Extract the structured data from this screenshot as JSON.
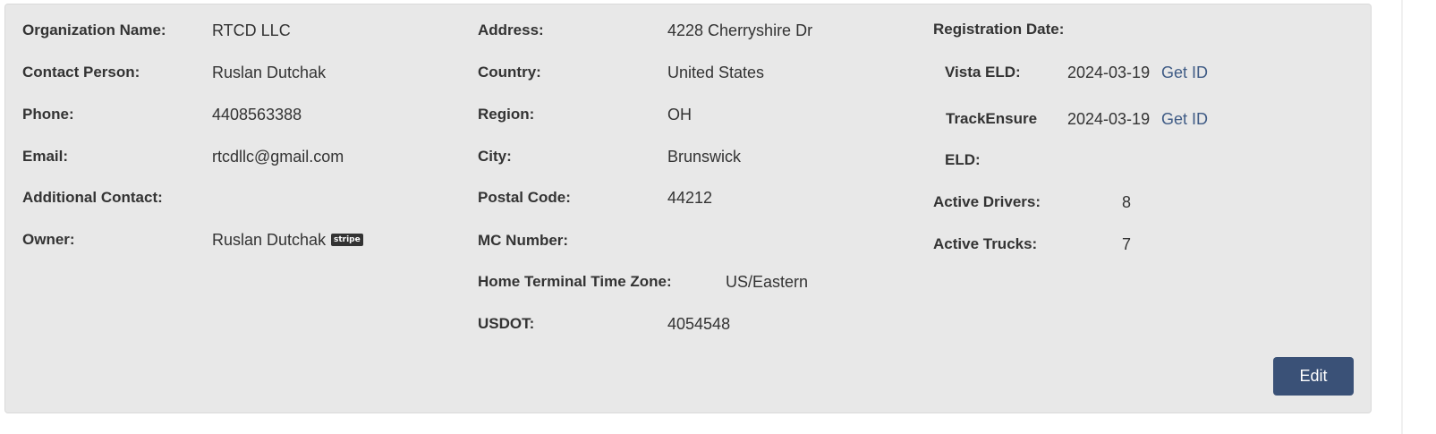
{
  "organization": {
    "name_label": "Organization Name:",
    "name_value": "RTCD LLC",
    "contact_label": "Contact Person:",
    "contact_value": "Ruslan Dutchak",
    "phone_label": "Phone:",
    "phone_value": "4408563388",
    "email_label": "Email:",
    "email_value": "rtcdllc@gmail.com",
    "additional_contact_label": "Additional Contact:",
    "additional_contact_value": "",
    "owner_label": "Owner:",
    "owner_value": "Ruslan Dutchak",
    "owner_badge": "stripe"
  },
  "address": {
    "address_label": "Address:",
    "address_value": "4228 Cherryshire Dr",
    "country_label": "Country:",
    "country_value": "United States",
    "region_label": "Region:",
    "region_value": "OH",
    "city_label": "City:",
    "city_value": "Brunswick",
    "postal_label": "Postal Code:",
    "postal_value": "44212",
    "mc_label": "MC Number:",
    "mc_value": "",
    "timezone_label": "Home Terminal Time Zone:",
    "timezone_value": "US/Eastern",
    "usdot_label": "USDOT:",
    "usdot_value": "4054548"
  },
  "registration": {
    "title": "Registration Date:",
    "vista_label": "Vista ELD:",
    "vista_date": "2024-03-19",
    "vista_link": "Get ID",
    "trackensure_label_line1": "TrackEnsure",
    "trackensure_label_line2": "ELD:",
    "trackensure_date": "2024-03-19",
    "trackensure_link": "Get ID",
    "active_drivers_label": "Active Drivers:",
    "active_drivers_value": "8",
    "active_trucks_label": "Active Trucks:",
    "active_trucks_value": "7"
  },
  "actions": {
    "edit_label": "Edit"
  },
  "colors": {
    "panel_bg": "#e8e8e8",
    "link": "#3f5b85",
    "button_bg": "#3a5177"
  }
}
